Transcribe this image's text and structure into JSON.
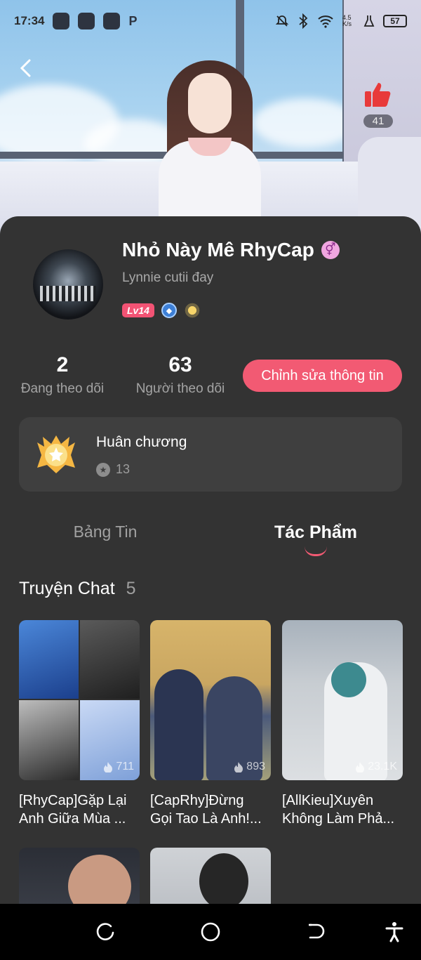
{
  "status_bar": {
    "time": "17:34",
    "net_speed": "4.5 K/s",
    "battery": "57"
  },
  "header": {
    "like_count": "41"
  },
  "profile": {
    "name": "Nhỏ Này Mê RhyCap",
    "bio": "Lynnie cutii đay",
    "level": "Lv14",
    "gender_symbol": "⚥"
  },
  "stats": {
    "following_count": "2",
    "following_label": "Đang theo dõi",
    "followers_count": "63",
    "followers_label": "Người theo dõi",
    "edit_button": "Chỉnh sửa thông tin"
  },
  "medals": {
    "title": "Huân chương",
    "count": "13"
  },
  "tabs": [
    {
      "label": "Bảng Tin",
      "active": false
    },
    {
      "label": "Tác Phẩm",
      "active": true
    }
  ],
  "section": {
    "title": "Truyện Chat",
    "count": "5"
  },
  "stories": [
    {
      "title_line1": "[RhyCap]Gặp Lại",
      "title_line2": "Anh Giữa Mùa ...",
      "views": "711"
    },
    {
      "title_line1": "[CapRhy]Đừng",
      "title_line2": "Gọi Tao Là Anh!...",
      "views": "893"
    },
    {
      "title_line1": "[AllKieu]Xuyên",
      "title_line2": "Không Làm Phả...",
      "views": "23.1K"
    }
  ],
  "colors": {
    "accent": "#f25a73",
    "sheet_bg": "#333333",
    "card_bg": "#3f3f3f"
  }
}
